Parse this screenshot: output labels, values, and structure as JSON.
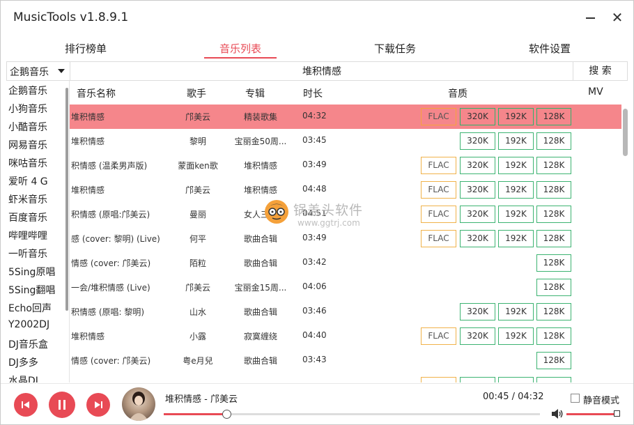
{
  "window": {
    "title": "MusicTools v1.8.9.1",
    "minimize": "",
    "close": "✕"
  },
  "tabs": [
    {
      "label": "排行榜单",
      "active": false
    },
    {
      "label": "音乐列表",
      "active": true
    },
    {
      "label": "下载任务",
      "active": false
    },
    {
      "label": "软件设置",
      "active": false
    }
  ],
  "search": {
    "source_selected": "企鹅音乐",
    "query": "堆积情感",
    "button": "搜 索"
  },
  "sources": [
    "企鹅音乐",
    "小狗音乐",
    "小酷音乐",
    "网易音乐",
    "咪咕音乐",
    "爱听 4 G",
    "虾米音乐",
    "百度音乐",
    "哔哩哔哩",
    "一听音乐",
    "5Sing原唱",
    "5Sing翻唱",
    "Echo回声",
    "Y2002DJ",
    "DJ音乐盒",
    "DJ多多",
    "水晶DJ"
  ],
  "columns": {
    "name": "音乐名称",
    "artist": "歌手",
    "album": "专辑",
    "duration": "时长",
    "quality": "音质",
    "mv": "MV"
  },
  "rows": [
    {
      "name": "堆积情感",
      "artist": "邝美云",
      "album": "精装歌集",
      "duration": "04:32",
      "flac": true,
      "q320": true,
      "q192": true,
      "q128": true,
      "selected": true
    },
    {
      "name": "堆积情感",
      "artist": "黎明",
      "album": "宝丽金50周...",
      "duration": "03:45",
      "flac": false,
      "q320": true,
      "q192": true,
      "q128": true
    },
    {
      "name": "积情感 (温柔男声版)",
      "artist": "蒙面ken歌",
      "album": "堆积情感",
      "duration": "03:49",
      "flac": true,
      "q320": true,
      "q192": true,
      "q128": true
    },
    {
      "name": "堆积情感",
      "artist": "邝美云",
      "album": "堆积情感",
      "duration": "04:48",
      "flac": true,
      "q320": true,
      "q192": true,
      "q128": true
    },
    {
      "name": "积情感 (原唱:邝美云)",
      "artist": "曼丽",
      "album": "女人三十",
      "duration": "04:51",
      "flac": true,
      "q320": true,
      "q192": true,
      "q128": true
    },
    {
      "name": "感 (cover: 黎明) (Live)",
      "artist": "何平",
      "album": "歌曲合辑",
      "duration": "03:49",
      "flac": true,
      "q320": true,
      "q192": true,
      "q128": true
    },
    {
      "name": "情感 (cover: 邝美云)",
      "artist": "陌粒",
      "album": "歌曲合辑",
      "duration": "03:42",
      "flac": false,
      "q320": false,
      "q192": false,
      "q128": true
    },
    {
      "name": "一会/堆积情感 (Live)",
      "artist": "邝美云",
      "album": "宝丽金15周...",
      "duration": "04:06",
      "flac": false,
      "q320": false,
      "q192": false,
      "q128": true
    },
    {
      "name": "积情感 (原唱: 黎明)",
      "artist": "山水",
      "album": "歌曲合辑",
      "duration": "03:46",
      "flac": false,
      "q320": true,
      "q192": true,
      "q128": true
    },
    {
      "name": "堆积情感",
      "artist": "小露",
      "album": "寂寞缠绕",
      "duration": "04:40",
      "flac": true,
      "q320": true,
      "q192": true,
      "q128": true
    },
    {
      "name": "情感 (cover: 邝美云)",
      "artist": "粤e月兒",
      "album": "歌曲合辑",
      "duration": "03:43",
      "flac": false,
      "q320": false,
      "q192": false,
      "q128": true
    }
  ],
  "quality_labels": {
    "flac": "FLAC",
    "q320": "320K",
    "q192": "192K",
    "q128": "128K"
  },
  "watermark": {
    "text": "锅盖头软件",
    "url": "www.ggtrj.com"
  },
  "player": {
    "now_playing": "堆积情感 - 邝美云",
    "time": "00:45 / 04:32",
    "progress": 0.166,
    "volume": 1.0,
    "mute_label": "静音模式",
    "mute": false
  },
  "colors": {
    "accent": "#e84a55",
    "selected_row": "#f5868b",
    "flac_border": "#f0b24a",
    "bitrate_border": "#3cb371"
  }
}
